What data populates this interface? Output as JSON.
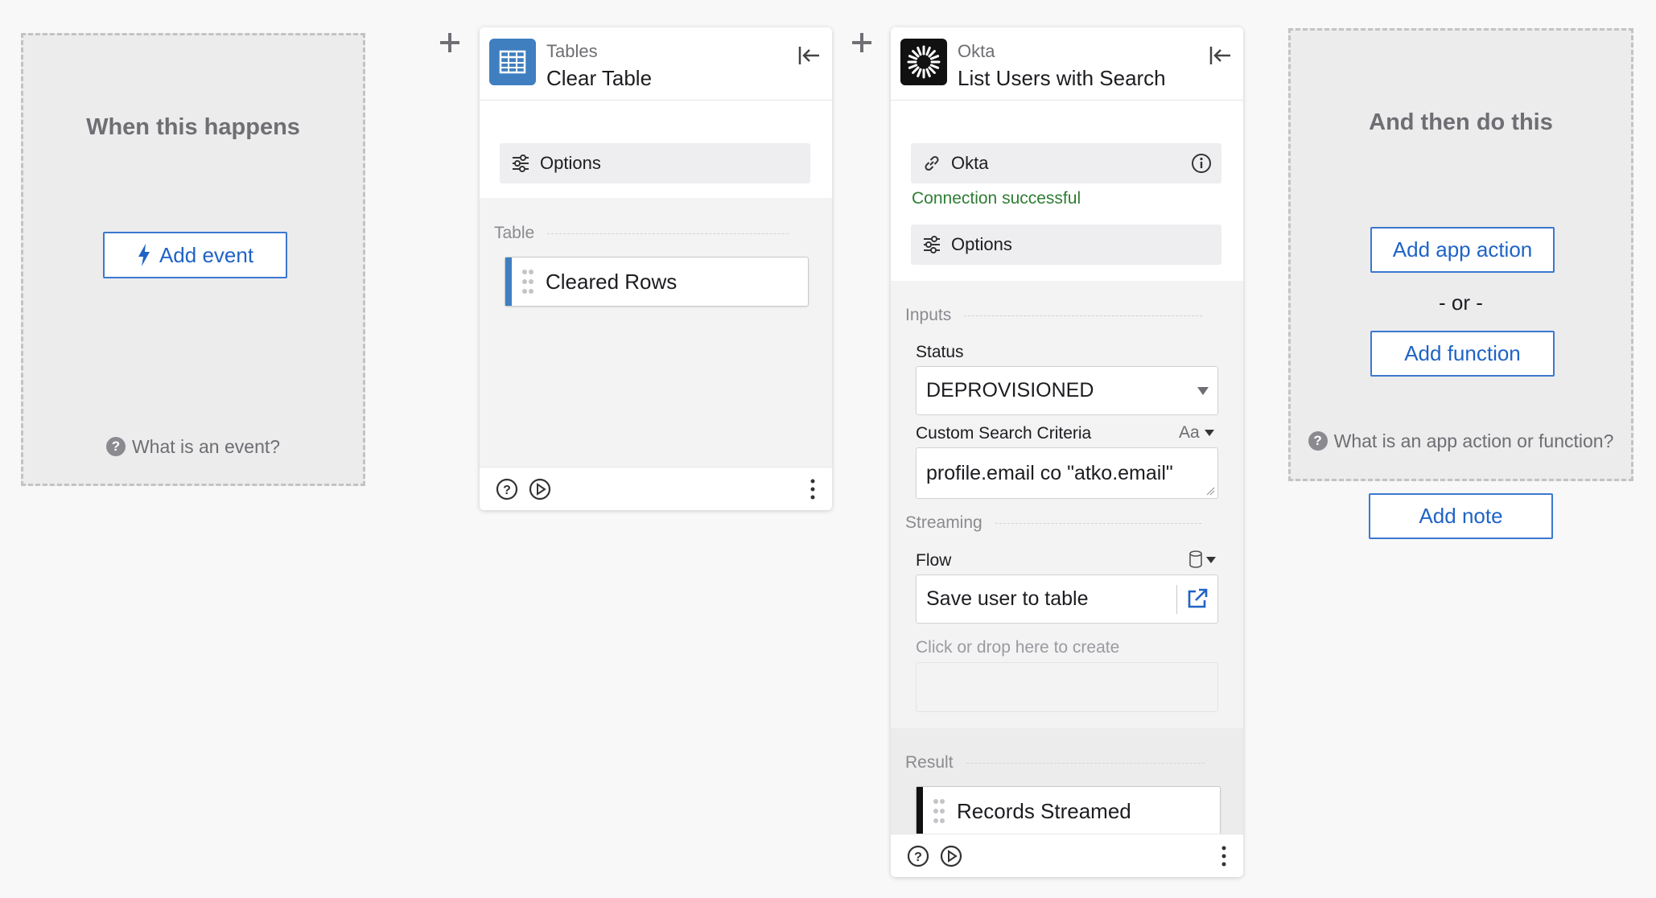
{
  "trigger": {
    "title": "When this happens",
    "add_event_label": "Add event",
    "help_text": "What is an event?"
  },
  "step1": {
    "app_name": "Tables",
    "step_name": "Clear Table",
    "options_label": "Options",
    "section_label": "Table",
    "result_token": "Cleared Rows"
  },
  "step2": {
    "app_name": "Okta",
    "step_name": "List Users with Search",
    "connection_name": "Okta",
    "connection_status": "Connection successful",
    "options_label": "Options",
    "inputs_label": "Inputs",
    "status_label": "Status",
    "status_value": "DEPROVISIONED",
    "criteria_label": "Custom Search Criteria",
    "criteria_type": "Aa",
    "criteria_value": "profile.email co \"atko.email\"",
    "streaming_label": "Streaming",
    "flow_label": "Flow",
    "flow_value": "Save user to table",
    "drop_hint": "Click or drop here to create",
    "result_label": "Result",
    "result_token": "Records Streamed"
  },
  "action": {
    "title": "And then do this",
    "add_app_action_label": "Add app action",
    "or_label": "- or -",
    "add_function_label": "Add function",
    "help_text": "What is an app action or function?"
  },
  "add_note_label": "Add note",
  "colors": {
    "accent": "#1f63c6",
    "success": "#2e7d32",
    "tables_brand": "#3f7fc0",
    "okta_brand": "#111111"
  }
}
